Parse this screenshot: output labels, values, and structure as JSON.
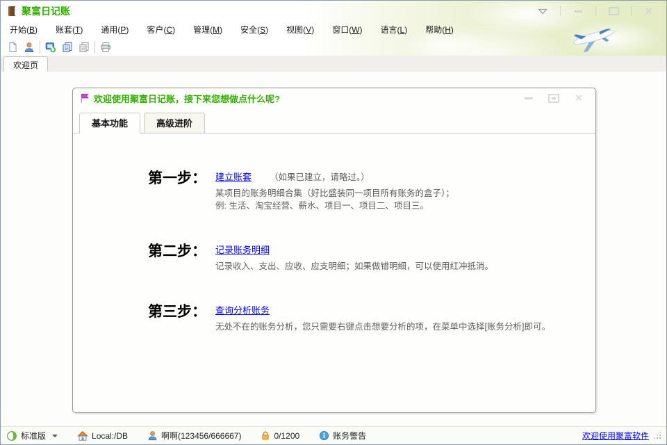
{
  "window": {
    "title": "聚富日记账"
  },
  "menu": {
    "paren_open": "(",
    "paren_close": ")",
    "items": [
      {
        "label": "开始",
        "mnemonic": "B"
      },
      {
        "label": "账套",
        "mnemonic": "T"
      },
      {
        "label": "通用",
        "mnemonic": "P"
      },
      {
        "label": "客户",
        "mnemonic": "C"
      },
      {
        "label": "管理",
        "mnemonic": "M"
      },
      {
        "label": "安全",
        "mnemonic": "S"
      },
      {
        "label": "视图",
        "mnemonic": "V"
      },
      {
        "label": "窗口",
        "mnemonic": "W"
      },
      {
        "label": "语言",
        "mnemonic": "L"
      },
      {
        "label": "帮助",
        "mnemonic": "H"
      }
    ]
  },
  "toolbar": {
    "icons": [
      "new-file-icon",
      "user-icon",
      "sync-message-icon",
      "copy-icon",
      "documents-icon",
      "printer-icon"
    ]
  },
  "outer_tabs": {
    "welcome": "欢迎页"
  },
  "welcome_window": {
    "title": "欢迎使用聚富日记账，接下来您想做点什么呢?",
    "tabs": [
      {
        "label": "基本功能",
        "active": true
      },
      {
        "label": "高级进阶",
        "active": false
      }
    ],
    "steps": [
      {
        "label": "第一步：",
        "link": "建立账套",
        "hint": "（如果已建立，请略过。）",
        "desc": [
          "某项目的账务明细合集（好比盛装同一项目所有账务的盒子）；",
          "例: 生活、淘宝经营、薪水、项目一、项目二、项目三。"
        ]
      },
      {
        "label": "第二步：",
        "link": "记录账务明细",
        "hint": "",
        "desc": [
          "记录收入、支出、应收、应支明细；如果做错明细，可以使用红冲抵消。"
        ]
      },
      {
        "label": "第三步：",
        "link": "查询分析账务",
        "hint": "",
        "desc": [
          "无处不在的账务分析，您只需要右键点击想要分析的项，在菜单中选择[账务分析]即可。"
        ]
      }
    ]
  },
  "statusbar": {
    "edition": "标准版",
    "database": "Local:/DB",
    "user": "啊啊(123456/666667)",
    "quota": "0/1200",
    "warning": "账务警告",
    "link": "欢迎使用聚富软件"
  },
  "colors": {
    "title_green": "#33ad00",
    "link_blue": "#0000ee",
    "flag_magenta": "#cc44dd"
  }
}
